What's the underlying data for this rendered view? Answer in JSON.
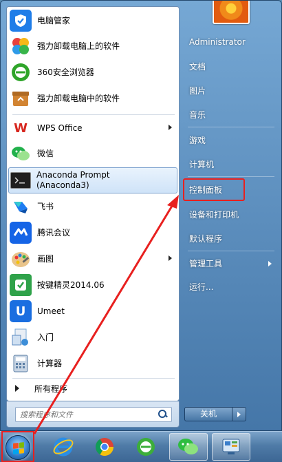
{
  "start_menu": {
    "programs": [
      {
        "label": "电脑管家",
        "icon": "shield-icon",
        "color": "#1f7de8"
      },
      {
        "label": "强力卸载电脑上的软件",
        "icon": "clover-icon",
        "color": "#e8413c"
      },
      {
        "label": "360安全浏览器",
        "icon": "browser-icon",
        "color": "#2fa52a"
      },
      {
        "label": "强力卸载电脑中的软件",
        "icon": "box-icon",
        "color": "#d28432"
      },
      {
        "label": "WPS Office",
        "icon": "wps-icon",
        "color": "#d7261e",
        "has_submenu": true
      },
      {
        "label": "微信",
        "icon": "wechat-icon",
        "color": "#22b14c"
      },
      {
        "label": "Anaconda Prompt\n(Anaconda3)",
        "icon": "terminal-icon",
        "color": "#1f1f1f",
        "selected": true
      },
      {
        "label": "飞书",
        "icon": "feishu-icon",
        "color": "#1d7cf2"
      },
      {
        "label": "腾讯会议",
        "icon": "meeting-icon",
        "color": "#1564e6"
      },
      {
        "label": "画图",
        "icon": "paint-icon",
        "color": "#d9883b",
        "has_submenu": true
      },
      {
        "label": "按键精灵2014.06",
        "icon": "keyboard-sprite-icon",
        "color": "#2fa24a"
      },
      {
        "label": "Umeet",
        "icon": "umeet-icon",
        "color": "#1a6ee0"
      },
      {
        "label": "入门",
        "icon": "getting-started-icon",
        "color": "#7aa7d3"
      },
      {
        "label": "计算器",
        "icon": "calculator-icon",
        "color": "#5c7fa5"
      }
    ],
    "all_programs_label": "所有程序",
    "search_placeholder": "搜索程序和文件",
    "right_items": [
      {
        "label": "Administrator"
      },
      {
        "label": "文档"
      },
      {
        "label": "图片"
      },
      {
        "label": "音乐"
      },
      {
        "label": "游戏"
      },
      {
        "label": "计算机"
      },
      {
        "label": "控制面板",
        "highlighted": true
      },
      {
        "label": "设备和打印机"
      },
      {
        "label": "默认程序"
      },
      {
        "label": "管理工具",
        "has_submenu": true
      },
      {
        "label": "运行..."
      }
    ],
    "shutdown_label": "关机"
  },
  "taskbar": {
    "items": [
      "start-button",
      "ie-icon",
      "chrome-icon",
      "360-browser-icon",
      "wechat-icon",
      "control-panel-icon"
    ]
  },
  "annotation_color": "#e8201f"
}
